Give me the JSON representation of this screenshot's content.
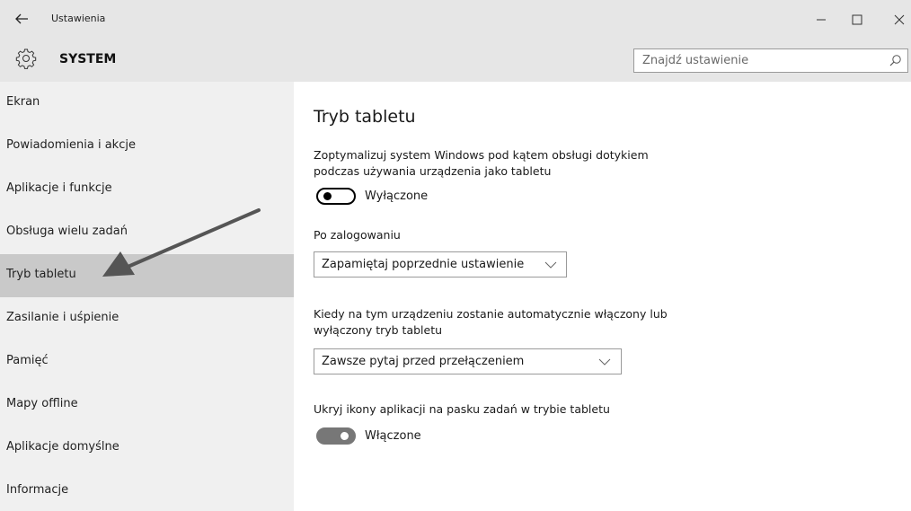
{
  "window": {
    "title": "Ustawienia",
    "controls": [
      "minimize",
      "maximize",
      "close"
    ]
  },
  "header": {
    "icon": "gear-icon",
    "title": "SYSTEM",
    "search_placeholder": "Znajdź ustawienie"
  },
  "sidebar": {
    "items": [
      {
        "label": "Ekran"
      },
      {
        "label": "Powiadomienia i akcje"
      },
      {
        "label": "Aplikacje i funkcje"
      },
      {
        "label": "Obsługa wielu zadań"
      },
      {
        "label": "Tryb tabletu",
        "active": true
      },
      {
        "label": "Zasilanie i uśpienie"
      },
      {
        "label": "Pamięć"
      },
      {
        "label": "Mapy offline"
      },
      {
        "label": "Aplikacje domyślne"
      },
      {
        "label": "Informacje"
      }
    ]
  },
  "main": {
    "title": "Tryb tabletu",
    "optimize_description": "Zoptymalizuj system Windows pod kątem obsługi dotykiem podczas używania urządzenia jako tabletu",
    "optimize_toggle": {
      "state": "off",
      "label": "Wyłączone"
    },
    "login_label": "Po zalogowaniu",
    "login_dropdown": {
      "value": "Zapamiętaj poprzednie ustawienie"
    },
    "auto_description": "Kiedy na tym urządzeniu zostanie automatycznie włączony lub wyłączony tryb tabletu",
    "auto_dropdown": {
      "value": "Zawsze pytaj przed przełączeniem"
    },
    "hide_icons_label": "Ukryj ikony aplikacji na pasku zadań w trybie tabletu",
    "hide_icons_toggle": {
      "state": "on",
      "label": "Włączone"
    }
  },
  "colors": {
    "titlebar_bg": "#e6e6e6",
    "sidebar_bg": "#f0f0f0",
    "sidebar_active_bg": "#c9c9c9",
    "toggle_on": "#777777",
    "annotation_arrow": "#555555"
  }
}
